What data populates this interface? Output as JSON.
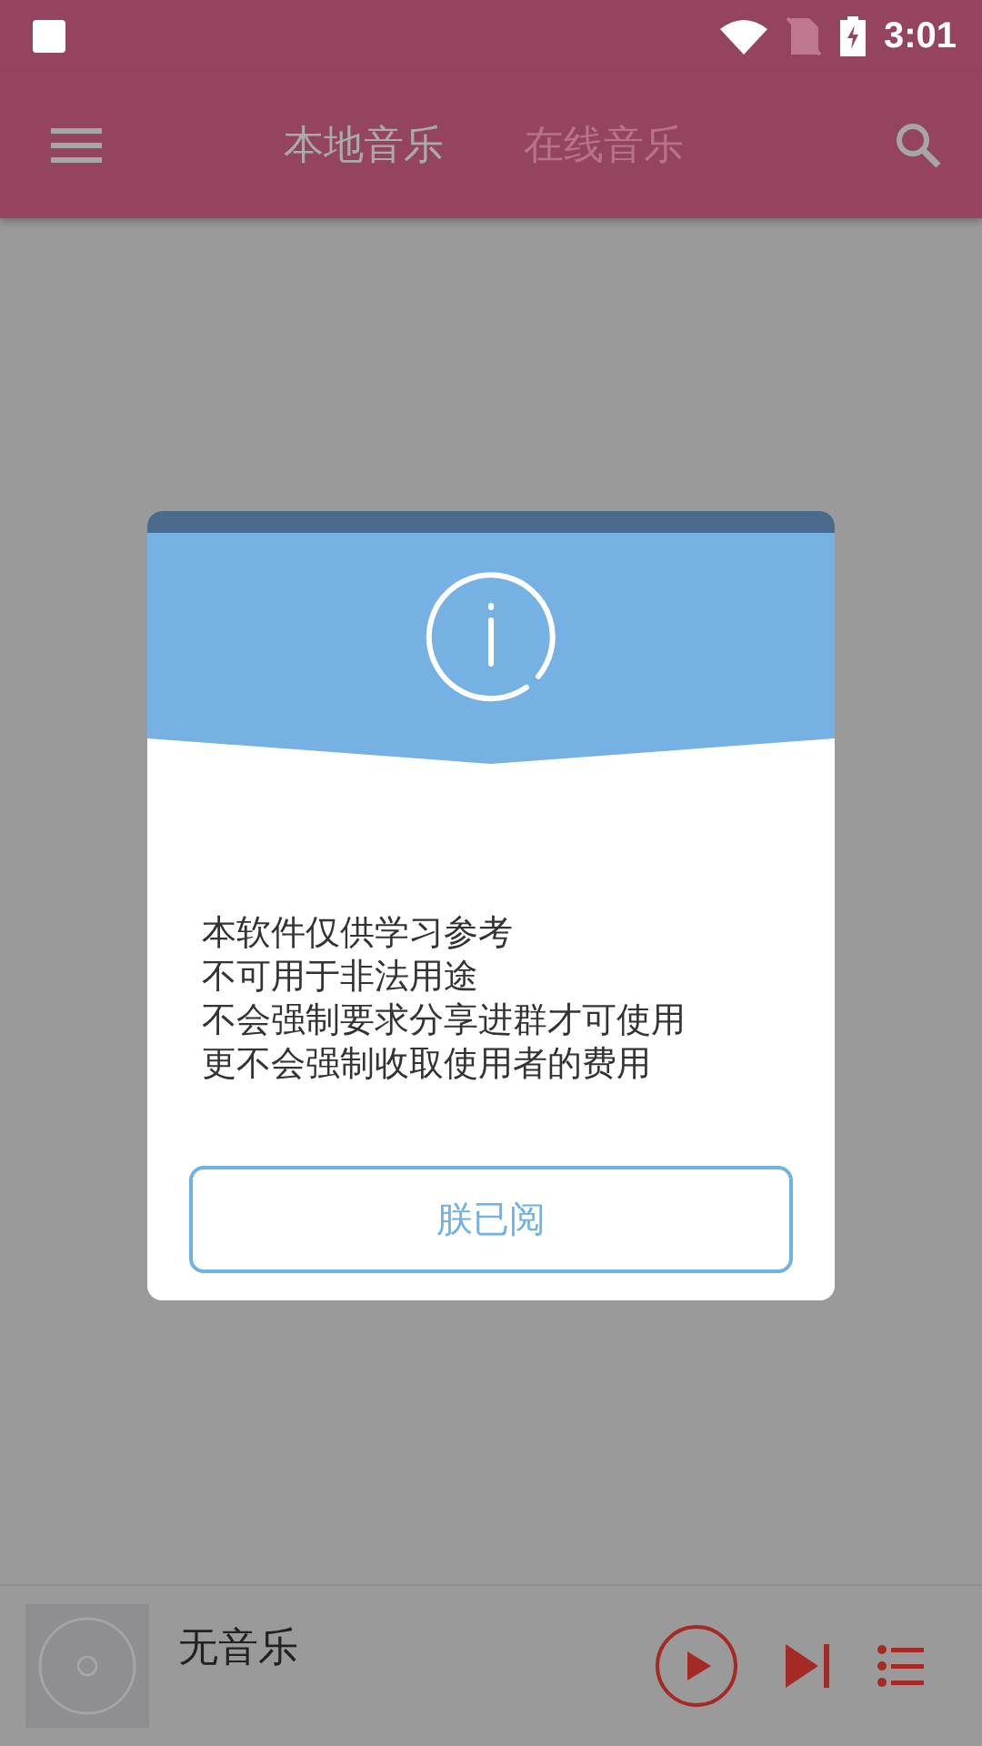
{
  "status_bar": {
    "time": "3:01"
  },
  "app_bar": {
    "tabs": [
      {
        "label": "本地音乐",
        "selected": true
      },
      {
        "label": "在线音乐",
        "selected": false
      }
    ]
  },
  "dialog": {
    "lines": [
      "本软件仅供学习参考",
      "不可用于非法用途",
      "不会强制要求分享进群才可使用",
      "更不会强制收取使用者的费用"
    ],
    "button": "朕已阅"
  },
  "player": {
    "title": "无音乐"
  }
}
